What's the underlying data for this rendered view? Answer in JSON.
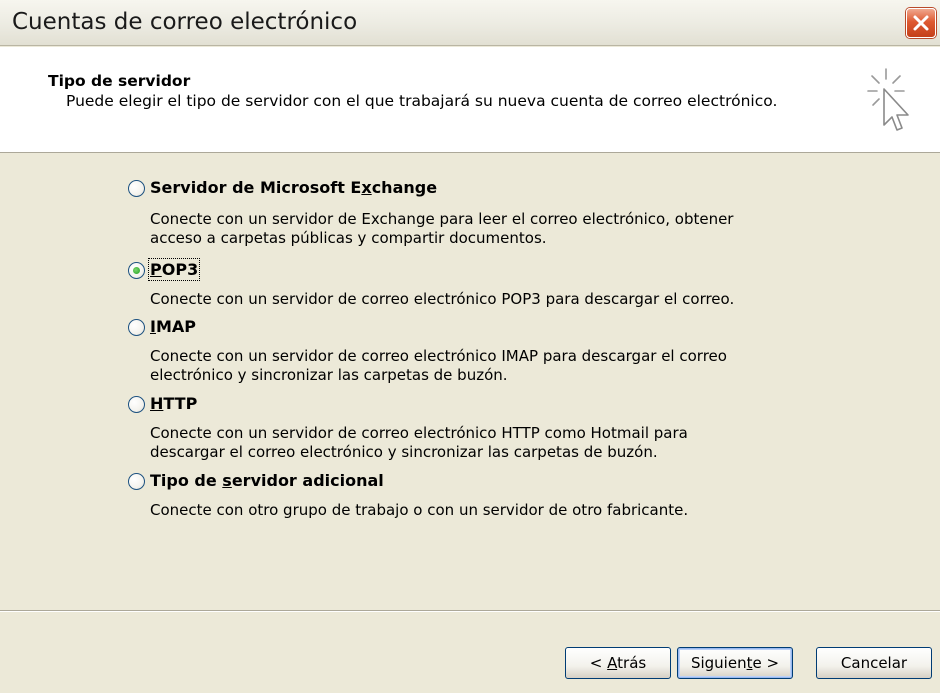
{
  "window": {
    "title": "Cuentas de correo electrónico",
    "close_icon": "close-icon"
  },
  "header": {
    "title": "Tipo de servidor",
    "subtitle": "Puede elegir el tipo de servidor con el que trabajará su nueva cuenta de correo electrónico.",
    "icon": "wizard-cursor-icon"
  },
  "options": [
    {
      "label_pre": "Servidor de Microsoft E",
      "label_key": "x",
      "label_post": "change",
      "checked": false,
      "desc_lines": [
        "Conecte con un servidor de Exchange para leer el correo electrónico, obtener",
        "acceso a carpetas públicas y compartir documentos."
      ]
    },
    {
      "label_pre": "",
      "label_key": "P",
      "label_post": "OP3",
      "checked": true,
      "desc_lines": [
        "Conecte con un servidor de correo electrónico POP3 para descargar el correo."
      ]
    },
    {
      "label_pre": "",
      "label_key": "I",
      "label_post": "MAP",
      "checked": false,
      "desc_lines": [
        "Conecte con un servidor de correo electrónico IMAP para descargar el correo",
        "electrónico y sincronizar las carpetas de buzón."
      ]
    },
    {
      "label_pre": "",
      "label_key": "H",
      "label_post": "TTP",
      "checked": false,
      "desc_lines": [
        "Conecte con un servidor de correo electrónico HTTP como Hotmail para",
        "descargar el correo electrónico y sincronizar las carpetas de buzón."
      ]
    },
    {
      "label_pre": "Tipo de ",
      "label_key": "s",
      "label_post": "ervidor adicional",
      "checked": false,
      "desc_lines": [
        "Conecte con otro grupo de trabajo o con un servidor de otro fabricante."
      ]
    }
  ],
  "buttons": {
    "back_pre": "< ",
    "back_key": "A",
    "back_post": "trás",
    "next_pre": "Siguien",
    "next_key": "t",
    "next_post": "e >",
    "cancel": "Cancelar"
  },
  "colors": {
    "dialog_bg": "#ece9d8",
    "header_bg": "#ffffff",
    "close_red": "#de5a32",
    "radio_border": "#1c5180",
    "radio_check": "#21a121"
  }
}
